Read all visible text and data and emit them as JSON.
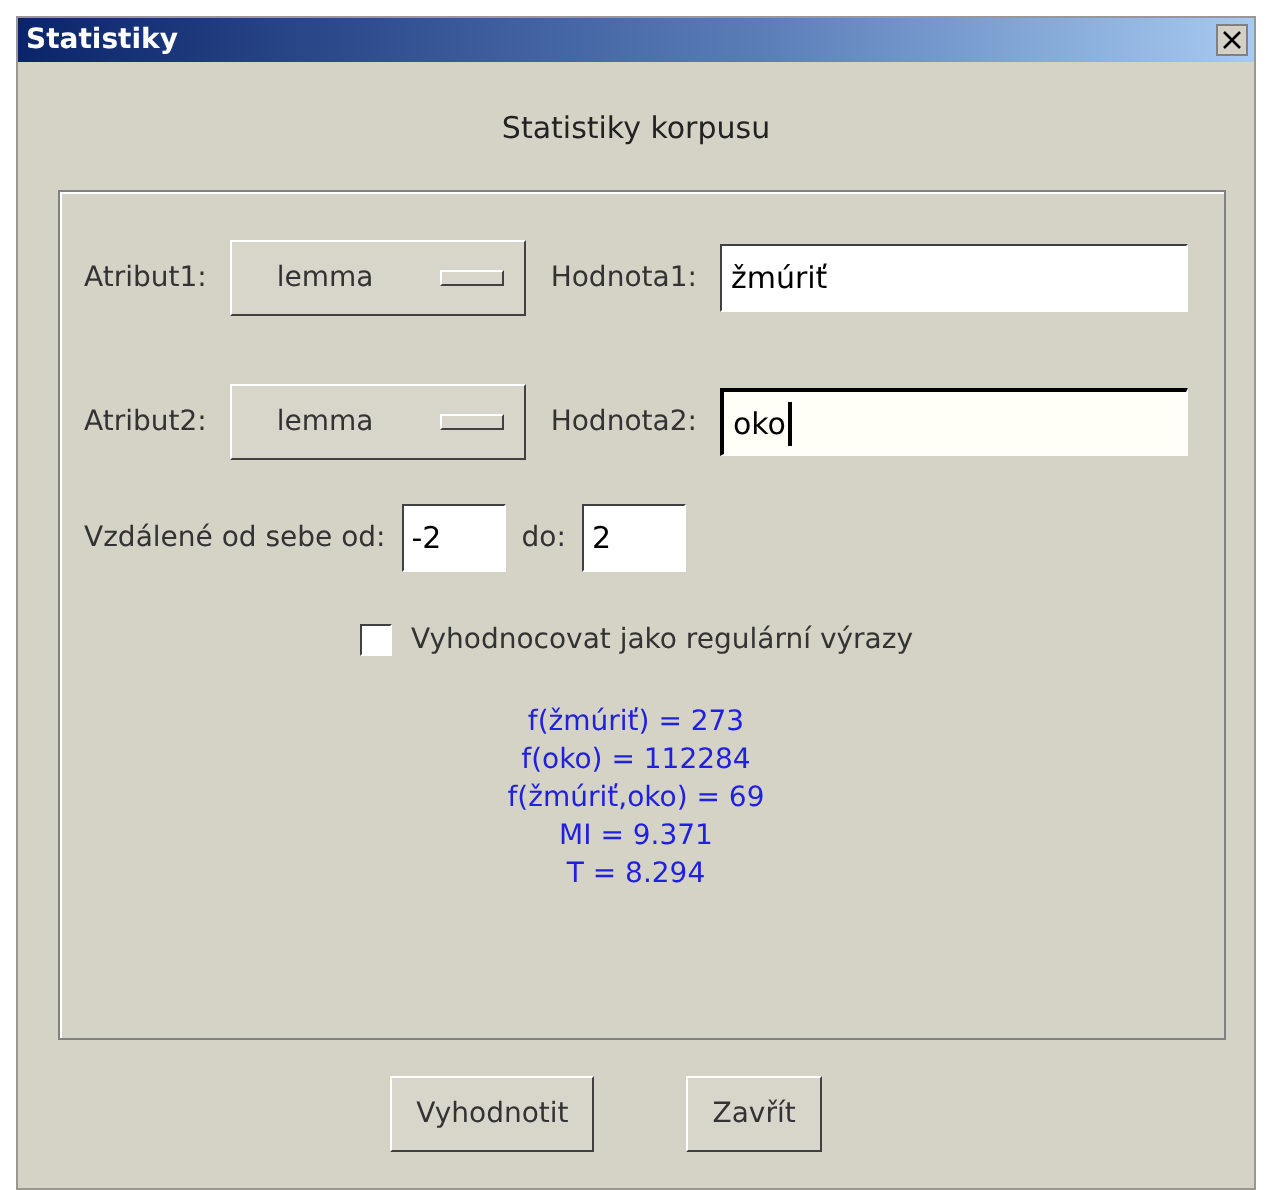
{
  "window": {
    "title": "Statistiky"
  },
  "heading": "Statistiky korpusu",
  "attributes": [
    {
      "label": "Atribut1:",
      "option": "lemma",
      "value_label": "Hodnota1:",
      "value": "žmúriť",
      "focused": false
    },
    {
      "label": "Atribut2:",
      "option": "lemma",
      "value_label": "Hodnota2:",
      "value": "oko",
      "focused": true
    }
  ],
  "distance": {
    "label": "Vzdálené od sebe od:",
    "from": "-2",
    "to_label": "do:",
    "to": "2"
  },
  "regex": {
    "label": "Vyhodnocovat jako regulární výrazy",
    "checked": false
  },
  "results": [
    "f(žmúriť) = 273",
    "f(oko) = 112284",
    "f(žmúriť,oko) = 69",
    "MI = 9.371",
    "T = 8.294"
  ],
  "buttons": [
    "Vyhodnotit",
    "Zavřít"
  ]
}
